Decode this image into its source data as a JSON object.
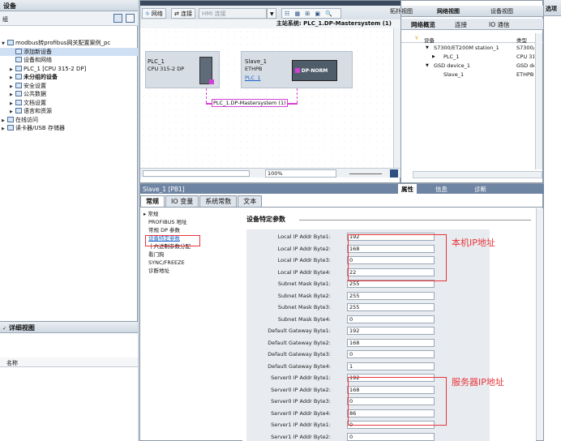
{
  "left_panel": {
    "title": "设备",
    "subheader": "组",
    "tree": [
      {
        "label": "modbus转profibus网关配置案例_pc",
        "level": 0,
        "expanded": true
      },
      {
        "label": "添加新设备",
        "level": 1,
        "selected": true
      },
      {
        "label": "设备和网络",
        "level": 1
      },
      {
        "label": "PLC_1 [CPU 315-2 DP]",
        "level": 1,
        "collapsed": true
      },
      {
        "label": "未分组的设备",
        "level": 1,
        "collapsed": true,
        "bold": true
      },
      {
        "label": "安全设置",
        "level": 1,
        "collapsed": true
      },
      {
        "label": "公共数据",
        "level": 1,
        "collapsed": true
      },
      {
        "label": "文档设置",
        "level": 1,
        "collapsed": true
      },
      {
        "label": "语言和资源",
        "level": 1,
        "collapsed": true
      },
      {
        "label": "在线访问",
        "level": 0,
        "collapsed": true
      },
      {
        "label": "读卡器/USB 存储器",
        "level": 0,
        "collapsed": true
      }
    ],
    "detail_title": "详细视图",
    "detail_col": "名称"
  },
  "center": {
    "toolbar": {
      "network": "网络",
      "connect": "连接",
      "conn_type": "HMI 连接"
    },
    "masterbar": "主站系统: PLC_1.DP-Mastersystem (1)",
    "plc": {
      "name": "PLC_1",
      "type": "CPU 315-2 DP"
    },
    "slave": {
      "name": "Slave_1",
      "type": "ETHPB",
      "link": "PLC_1",
      "module": "DP-NORM"
    },
    "bus_label": "PLC_1.DP-Mastersystem (1)",
    "zoom": "100%"
  },
  "right": {
    "view_tabs": [
      "拓扑视图",
      "网络视图",
      "设备视图"
    ],
    "sub_tabs": [
      "网络概览",
      "连接",
      "IO 通信"
    ],
    "col_device": "设备",
    "col_type": "类型",
    "rows": [
      {
        "name": "S7300/ET200M station_1",
        "type": "S7300/E...",
        "level": 1
      },
      {
        "name": "PLC_1",
        "type": "CPU 31...",
        "level": 2
      },
      {
        "name": "GSD device_1",
        "type": "GSD de...",
        "level": 1
      },
      {
        "name": "Slave_1",
        "type": "ETHPB",
        "level": 2
      }
    ],
    "far_title": "选项"
  },
  "props": {
    "title": "Slave_1 [PB1]",
    "tabs": [
      "属性",
      "信息",
      "诊断"
    ],
    "gen_tabs": [
      "常规",
      "IO 变量",
      "系统常数",
      "文本"
    ],
    "nav": [
      "常规",
      "PROFIBUS 地址",
      "常规 DP 参数",
      "设备特定参数",
      "十六进制参数分配",
      "看门狗",
      "SYNC/FREEZE",
      "诊断地址"
    ],
    "section": "设备特定参数",
    "fields": [
      {
        "label": "Local IP Addr Byte1:",
        "value": "192"
      },
      {
        "label": "Local IP Addr Byte2:",
        "value": "168"
      },
      {
        "label": "Local IP Addr Byte3:",
        "value": "0"
      },
      {
        "label": "Local IP Addr Byte4:",
        "value": "22"
      },
      {
        "label": "Subnet Mask Byte1:",
        "value": "255"
      },
      {
        "label": "Subnet Mask Byte2:",
        "value": "255"
      },
      {
        "label": "Subnet Mask Byte3:",
        "value": "255"
      },
      {
        "label": "Subnet Mask Byte4:",
        "value": "0"
      },
      {
        "label": "Default Gateway Byte1:",
        "value": "192"
      },
      {
        "label": "Default Gateway Byte2:",
        "value": "168"
      },
      {
        "label": "Default Gateway Byte3:",
        "value": "0"
      },
      {
        "label": "Default Gateway Byte4:",
        "value": "1"
      },
      {
        "label": "Server0 IP Addr Byte1:",
        "value": "192"
      },
      {
        "label": "Server0 IP Addr Byte2:",
        "value": "168"
      },
      {
        "label": "Server0 IP Addr Byte3:",
        "value": "0"
      },
      {
        "label": "Server0 IP Addr Byte4:",
        "value": "86"
      },
      {
        "label": "Server1 IP Addr Byte1:",
        "value": "0"
      },
      {
        "label": "Server1 IP Addr Byte2:",
        "value": "0"
      }
    ],
    "anno_local": "本机IP地址",
    "anno_server": "服务器IP地址"
  },
  "colors": {
    "accent": "#1c4f8f",
    "annotation": "#e8343a",
    "selected": "#1c63c9"
  }
}
